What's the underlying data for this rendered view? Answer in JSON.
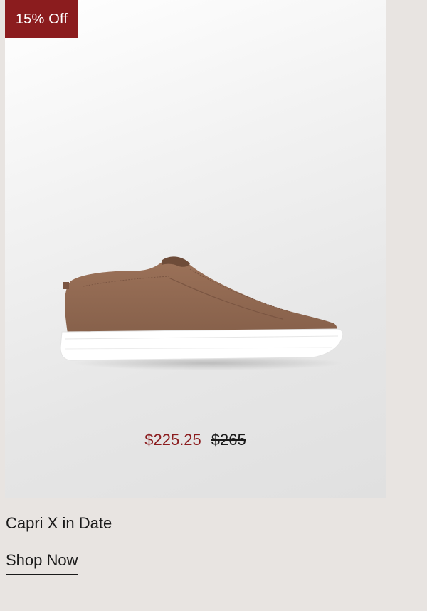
{
  "badge": {
    "label": "15% Off",
    "color": "#8b1c1e"
  },
  "product": {
    "image_icon": "slip-on-sneaker-image",
    "sale_price": "$225.25",
    "original_price": "$265",
    "name": "Capri X in Date"
  },
  "cta": {
    "label": "Shop Now"
  },
  "colors": {
    "background": "#e8e4e1",
    "accent": "#8b1c1e",
    "shoe_suede": "#9a7058",
    "sole": "#ffffff"
  }
}
